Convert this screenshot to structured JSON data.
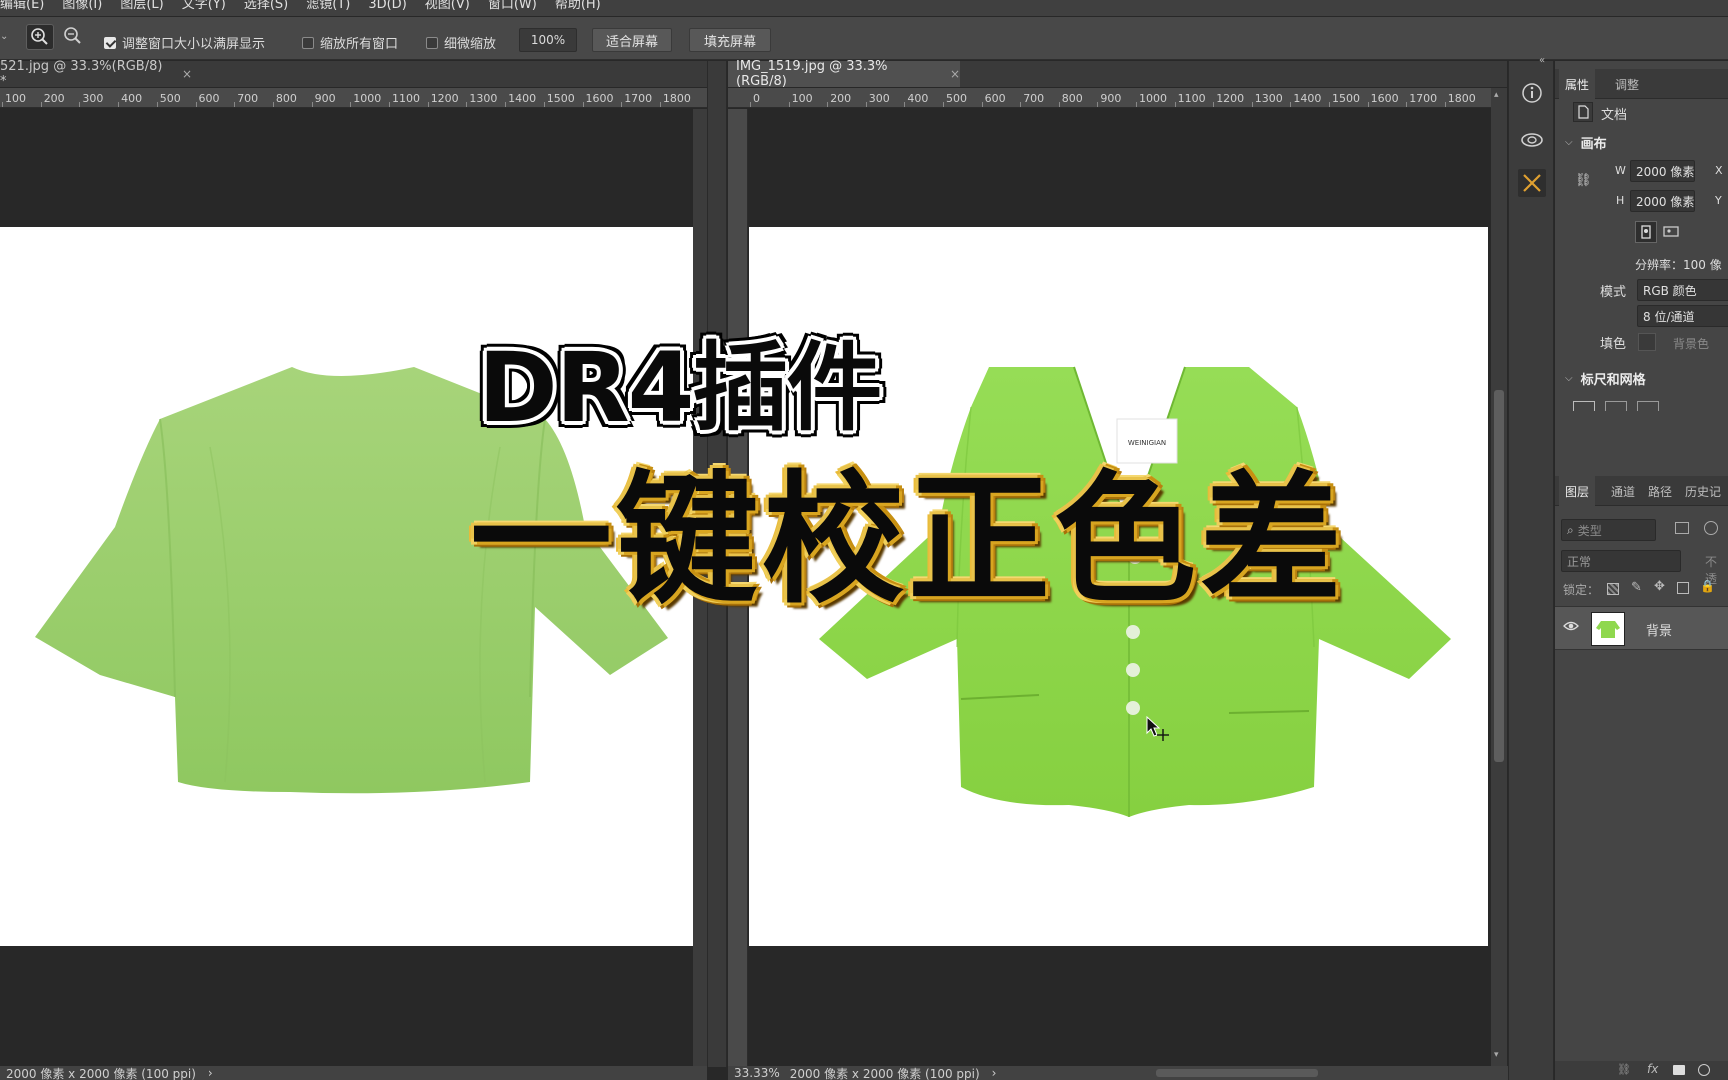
{
  "menu": [
    "编辑(E)",
    "图像(I)",
    "图层(L)",
    "文字(Y)",
    "选择(S)",
    "滤镜(T)",
    "3D(D)",
    "视图(V)",
    "窗口(W)",
    "帮助(H)"
  ],
  "options": {
    "resize_windows": "调整窗口大小以满屏显示",
    "zoom_all_windows": "缩放所有窗口",
    "scrubby_zoom": "细微缩放",
    "zoom_value": "100%",
    "fit_screen": "适合屏幕",
    "fill_screen": "填充屏幕"
  },
  "tabs": {
    "left": "521.jpg @ 33.3%(RGB/8) *",
    "right": "IMG_1519.jpg @ 33.3%(RGB/8)",
    "close": "×"
  },
  "ruler_left": [
    "100",
    "200",
    "300",
    "400",
    "500",
    "600",
    "700",
    "800",
    "900",
    "1000",
    "1100",
    "1200",
    "1300",
    "1400",
    "1500",
    "1600",
    "1700",
    "1800"
  ],
  "ruler_right": [
    "0",
    "100",
    "200",
    "300",
    "400",
    "500",
    "600",
    "700",
    "800",
    "900",
    "1000",
    "1100",
    "1200",
    "1300",
    "1400",
    "1500",
    "1600",
    "1700",
    "1800"
  ],
  "status": {
    "left": "2000 像素 x 2000 像素 (100 ppi)",
    "right_zoom": "33.33%",
    "right_info": "2000 像素 x 2000 像素 (100 ppi)",
    "arrow": "›"
  },
  "overlay": {
    "line1": "DR4插件",
    "line2": "一键校正色差"
  },
  "label_text": "WEINIGIAN",
  "properties": {
    "tab_properties": "属性",
    "tab_adjust": "调整",
    "doc_label": "文档",
    "canvas_section": "画布",
    "w_label": "W",
    "w_value": "2000 像素",
    "x_label": "X",
    "h_label": "H",
    "h_value": "2000 像素",
    "y_label": "Y",
    "resolution": "分辨率：100 像",
    "mode_label": "模式",
    "mode_value": "RGB 颜色",
    "bit_value": "8 位/通道",
    "fill_label": "填色",
    "fill_value": "背景色",
    "rulers_section": "标尺和网格"
  },
  "layers": {
    "tab_layers": "图层",
    "tab_channels": "通道",
    "tab_paths": "路径",
    "tab_history": "历史记",
    "kind_placeholder": "类型",
    "blend_mode": "正常",
    "opacity_label": "不透",
    "lock_label": "锁定：",
    "layer_name": "背景"
  },
  "colors": {
    "shirt_left": "#9ccf6c",
    "shirt_right": "#8fd84e",
    "panel_bg": "#454545",
    "canvas_bg": "#282828"
  }
}
